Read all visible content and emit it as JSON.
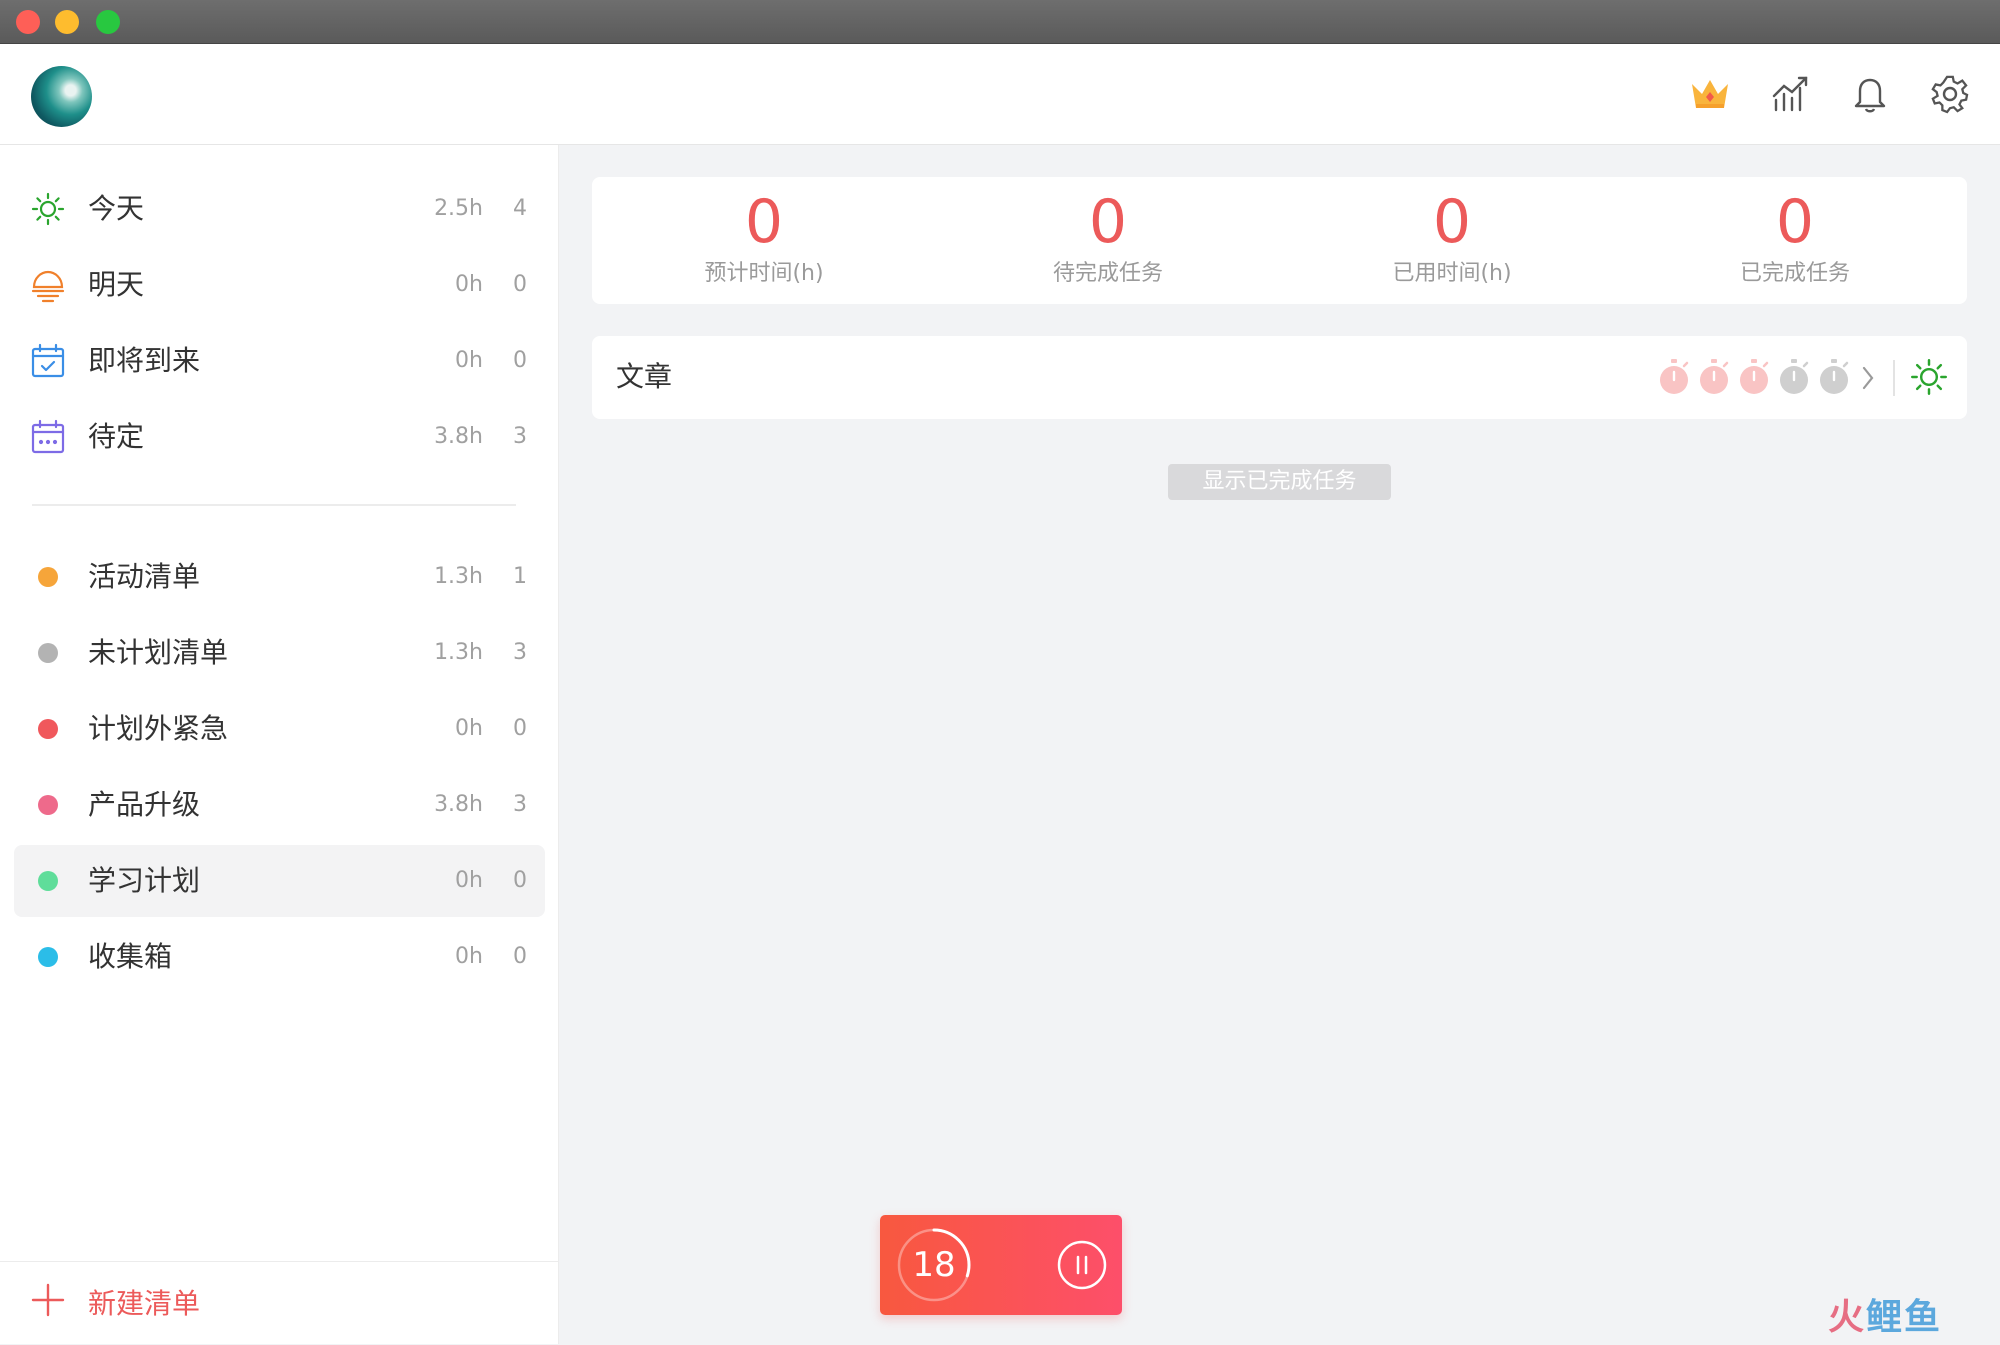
{
  "window": {
    "controls": [
      "close",
      "minimize",
      "maximize"
    ]
  },
  "header": {
    "avatar": "wave-avatar",
    "icons": [
      "crown-icon",
      "statistics-icon",
      "bell-icon",
      "gear-icon"
    ]
  },
  "sidebar": {
    "smart_lists": [
      {
        "label": "今天",
        "hours": "2.5h",
        "count": "4",
        "icon": "sun-icon",
        "color": "#2aa52e"
      },
      {
        "label": "明天",
        "hours": "0h",
        "count": "0",
        "icon": "sunrise-icon",
        "color": "#f0802b"
      },
      {
        "label": "即将到来",
        "hours": "0h",
        "count": "0",
        "icon": "calendar-check-icon",
        "color": "#3a8ee6"
      },
      {
        "label": "待定",
        "hours": "3.8h",
        "count": "3",
        "icon": "calendar-dots-icon",
        "color": "#7d6be6"
      }
    ],
    "lists": [
      {
        "label": "活动清单",
        "hours": "1.3h",
        "count": "1",
        "color": "#f6a53a"
      },
      {
        "label": "未计划清单",
        "hours": "1.3h",
        "count": "3",
        "color": "#b3b3b3"
      },
      {
        "label": "计划外紧急",
        "hours": "0h",
        "count": "0",
        "color": "#f0585c"
      },
      {
        "label": "产品升级",
        "hours": "3.8h",
        "count": "3",
        "color": "#ee6a8b"
      },
      {
        "label": "学习计划",
        "hours": "0h",
        "count": "0",
        "color": "#5fdd9a",
        "selected": true
      },
      {
        "label": "收集箱",
        "hours": "0h",
        "count": "0",
        "color": "#2bbde8"
      }
    ],
    "new_list_label": "新建清单"
  },
  "stats": [
    {
      "value": "0",
      "label": "预计时间(h)"
    },
    {
      "value": "0",
      "label": "待完成任务"
    },
    {
      "value": "0",
      "label": "已用时间(h)"
    },
    {
      "value": "0",
      "label": "已完成任务"
    }
  ],
  "task": {
    "title": "文章",
    "pomodoros_estimated": 5,
    "pomodoros_highlighted": 3,
    "icons": [
      "pomodoro-icon",
      "chevron-right-icon",
      "sun-icon"
    ]
  },
  "show_completed_label": "显示已完成任务",
  "timer": {
    "minutes": "18",
    "progress": 0.3
  },
  "watermark": {
    "text_red": "火",
    "text_blue": "鲤鱼"
  },
  "colors": {
    "accent": "#ec5a5a",
    "timer_start": "#f8583f",
    "timer_end": "#fd4f6a"
  }
}
